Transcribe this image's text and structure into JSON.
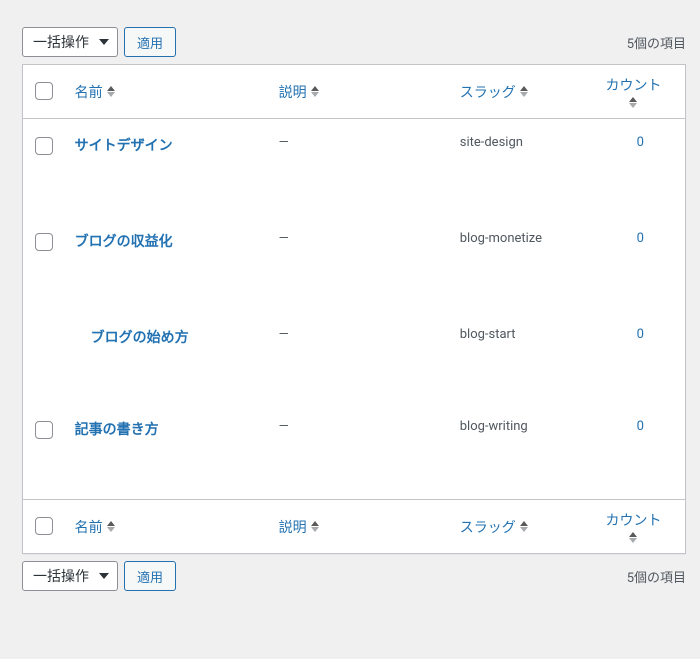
{
  "bulk": {
    "label": "一括操作",
    "apply": "適用"
  },
  "count_text": "5個の項目",
  "columns": {
    "name": "名前",
    "description": "説明",
    "slug": "スラッグ",
    "count": "カウント"
  },
  "rows": [
    {
      "name": "サイトデザイン",
      "description": "—",
      "slug": "site-design",
      "count": "0",
      "indent": 0,
      "checkbox": true
    },
    {
      "name": "ブログの収益化",
      "description": "—",
      "slug": "blog-monetize",
      "count": "0",
      "indent": 0,
      "checkbox": true
    },
    {
      "name": "ブログの始め方",
      "description": "—",
      "slug": "blog-start",
      "count": "0",
      "indent": 1,
      "checkbox": false
    },
    {
      "name": "記事の書き方",
      "description": "—",
      "slug": "blog-writing",
      "count": "0",
      "indent": 0,
      "checkbox": true
    }
  ]
}
